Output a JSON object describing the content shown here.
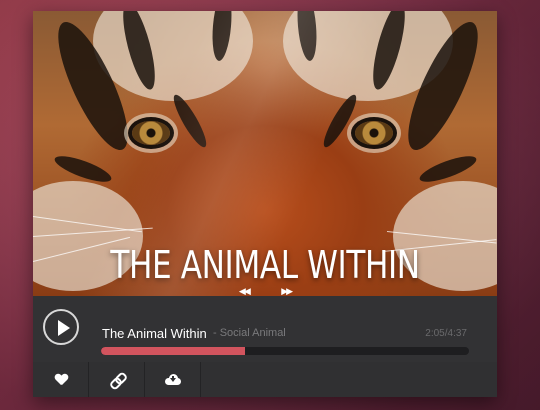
{
  "album": {
    "title": "THE ANIMAL WITHIN",
    "prev_glyph": "◀◀",
    "next_glyph": "▶▶"
  },
  "track": {
    "title": "The Animal Within",
    "artist": "- Social Animal",
    "time": "2:05/4:37",
    "progress": 0.39
  },
  "icons": {
    "play": "play-icon",
    "like": "heart-icon",
    "share": "link-icon",
    "download": "cloud-download-icon"
  },
  "colors": {
    "accent": "#d2545e",
    "panel": "#323234",
    "background": "#8e3550"
  }
}
